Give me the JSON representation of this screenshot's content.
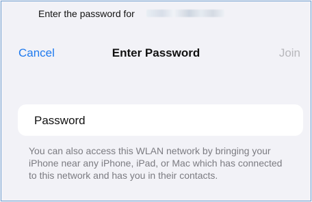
{
  "header": {
    "prompt_prefix": "Enter the password for"
  },
  "nav": {
    "cancel_label": "Cancel",
    "title": "Enter Password",
    "join_label": "Join"
  },
  "password_field": {
    "placeholder": "Password",
    "value": ""
  },
  "footer": {
    "note": "You can also access this WLAN network by bringing your iPhone near any iPhone, iPad, or Mac which has connected to this network and has you in their contacts."
  },
  "colors": {
    "background": "#f2f2f7",
    "accent": "#1f7aee",
    "disabled": "#b7b7bb",
    "card": "#ffffff",
    "secondary_text": "#7b7b81"
  }
}
